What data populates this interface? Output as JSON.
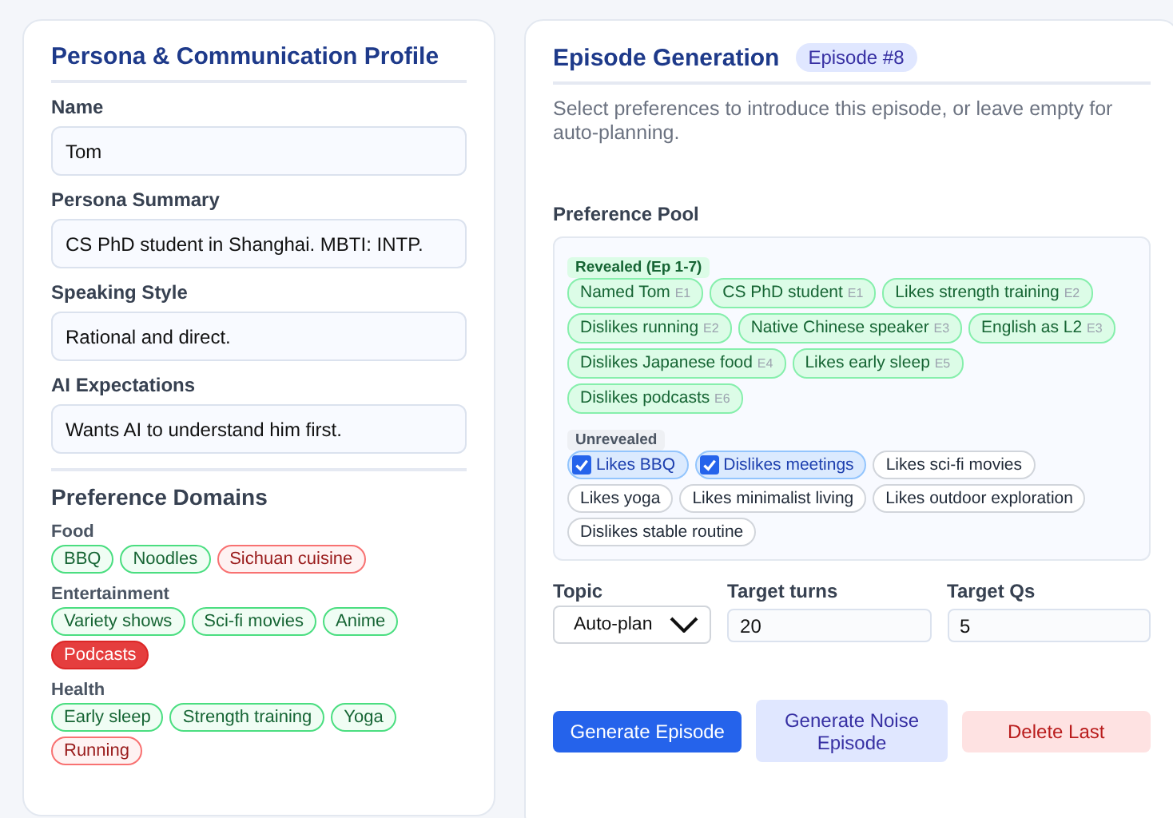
{
  "profile": {
    "title": "Persona & Communication Profile",
    "fields": [
      {
        "label": "Name",
        "value": "Tom"
      },
      {
        "label": "Persona Summary",
        "value": "CS PhD student in Shanghai. MBTI: INTP."
      },
      {
        "label": "Speaking Style",
        "value": "Rational and direct."
      },
      {
        "label": "AI Expectations",
        "value": "Wants AI to understand him first."
      }
    ],
    "domains_title": "Preference Domains",
    "domains": [
      {
        "name": "Food",
        "tags": [
          {
            "label": "BBQ",
            "kind": "like"
          },
          {
            "label": "Noodles",
            "kind": "like"
          },
          {
            "label": "Sichuan cuisine",
            "kind": "dislike"
          }
        ]
      },
      {
        "name": "Entertainment",
        "tags": [
          {
            "label": "Variety shows",
            "kind": "like"
          },
          {
            "label": "Sci-fi movies",
            "kind": "like"
          },
          {
            "label": "Anime",
            "kind": "like"
          },
          {
            "label": "Podcasts",
            "kind": "strong_dislike"
          }
        ]
      },
      {
        "name": "Health",
        "tags": [
          {
            "label": "Early sleep",
            "kind": "like"
          },
          {
            "label": "Strength training",
            "kind": "like"
          },
          {
            "label": "Yoga",
            "kind": "like"
          },
          {
            "label": "Running",
            "kind": "dislike"
          }
        ]
      }
    ]
  },
  "episode": {
    "title": "Episode Generation",
    "badge": "Episode #8",
    "description": "Select preferences to introduce this episode, or leave empty for auto-planning.",
    "pool_title": "Preference Pool",
    "revealed_label": "Revealed (Ep 1-7)",
    "revealed": [
      {
        "label": "Named Tom",
        "episode": "E1"
      },
      {
        "label": "CS PhD student",
        "episode": "E1"
      },
      {
        "label": "Likes strength training",
        "episode": "E2"
      },
      {
        "label": "Dislikes running",
        "episode": "E2"
      },
      {
        "label": "Native Chinese speaker",
        "episode": "E3"
      },
      {
        "label": "English as L2",
        "episode": "E3"
      },
      {
        "label": "Dislikes Japanese food",
        "episode": "E4"
      },
      {
        "label": "Likes early sleep",
        "episode": "E5"
      },
      {
        "label": "Dislikes podcasts",
        "episode": "E6"
      }
    ],
    "unrevealed_label": "Unrevealed",
    "unrevealed": [
      {
        "label": "Likes BBQ",
        "checked": true
      },
      {
        "label": "Dislikes meetings",
        "checked": true
      },
      {
        "label": "Likes sci-fi movies",
        "checked": false
      },
      {
        "label": "Likes yoga",
        "checked": false
      },
      {
        "label": "Likes minimalist living",
        "checked": false
      },
      {
        "label": "Likes outdoor exploration",
        "checked": false
      },
      {
        "label": "Dislikes stable routine",
        "checked": false
      }
    ],
    "topic": {
      "label": "Topic",
      "value": "Auto-plan"
    },
    "target_turns": {
      "label": "Target turns",
      "value": "20"
    },
    "target_qs": {
      "label": "Target Qs",
      "value": "5"
    },
    "buttons": [
      {
        "label": "Generate Episode",
        "kind": "primary"
      },
      {
        "label": "Generate Noise Episode",
        "kind": "secondary"
      },
      {
        "label": "Delete Last",
        "kind": "danger"
      }
    ]
  }
}
